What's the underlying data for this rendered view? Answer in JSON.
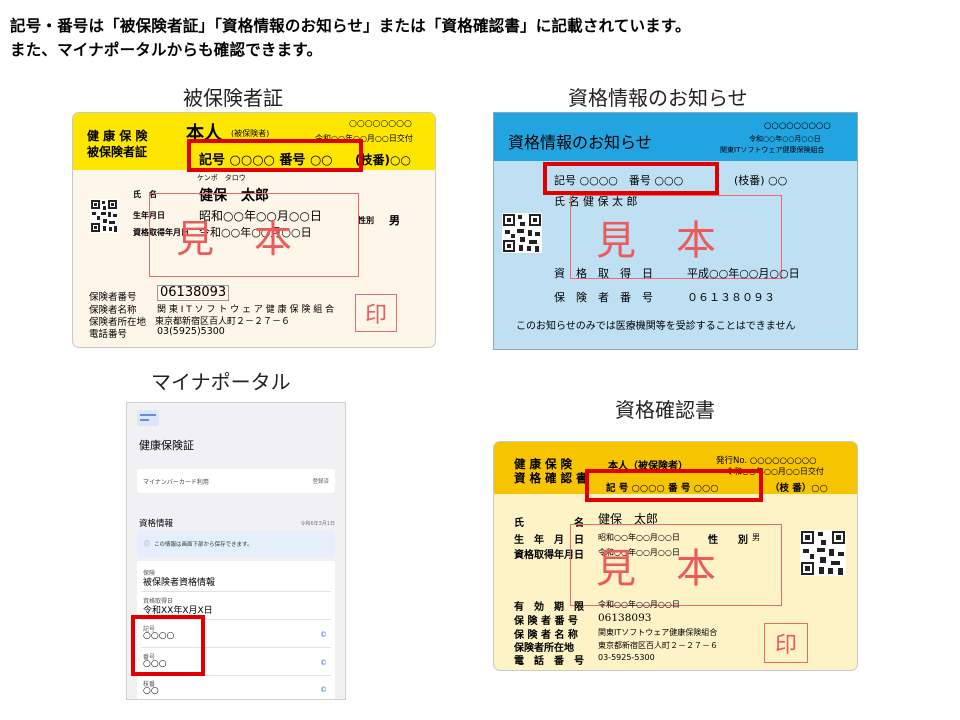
{
  "intro": {
    "line1": "記号・番号は「被保険者証」「資格情報のお知らせ」または「資格確認書」に記載されています。",
    "line2": "また、マイナポータルからも確認できます。"
  },
  "captions": {
    "insurance_card": "被保険者証",
    "notice": "資格情報のお知らせ",
    "myna_portal": "マイナポータル",
    "certificate": "資格確認書"
  },
  "insurance_card": {
    "header_left_1": "健 康 保 険",
    "header_left_2": "被保険者証",
    "person": "本人",
    "person_sub": "(被保険者)",
    "issue_no": "○○○○○○○○",
    "issue_date": "令和○○年○○月○○日交付",
    "kigo": "記号 ○○○○ 番号 ○○",
    "edaban": "(枝番)○○",
    "furigana": "ケンポ　タロウ",
    "name_label": "氏　名",
    "name": "健保　太郎",
    "birth_label": "生年月日",
    "birth": "昭和○○年○○月○○日",
    "sex_label": "性別",
    "sex": "男",
    "acq_label": "資格取得年月日",
    "acq": "令和○○年○○月○○日",
    "insurer_no_label": "保険者番号",
    "insurer_no": "06138093",
    "insurer_name_label": "保険者名称",
    "insurer_name": "関 東 I T ソ フ ト ウ ェ ア 健 康 保 険 組 合",
    "address_label": "保険者所在地",
    "address": "東京都新宿区百人町２－２７－６",
    "phone_label": "電話番号",
    "phone": "03(5925)5300",
    "sample": "見本",
    "seal": "印",
    "color_header": "#ffe600",
    "color_body": "#fdf6e9"
  },
  "notice": {
    "title": "資格情報のお知らせ",
    "issue_no": "○○○○○○○○○",
    "issue_date": "令和○○年○○月○○日",
    "insurer": "関東ITソフトウェア健康保険組合",
    "kigo": "記号 ○○○○　番号 ○○○",
    "edaban": "(枝番) ○○",
    "name_line": "氏 名  健 保   太 郎",
    "acq_label": "資　格　取　得　日",
    "acq": "平成○○年○○月○○日",
    "insurer_no_label": "保　険　者　番　号",
    "insurer_no": "０６１３８０９３",
    "footer": "このお知らせのみでは医療機関等を受診することはできません",
    "sample": "見本",
    "color_header": "#21a4e0",
    "color_body": "#bfe0f3"
  },
  "myna": {
    "section_title": "健康保険証",
    "card_use_label": "マイナンバーカード利用",
    "card_use_value": "登録済",
    "info_title": "資格情報",
    "info_date": "令和6年3月1日",
    "notice_text": "この情報は画面下部から保存できます。",
    "field1_label": "保険",
    "field1_value": "被保険者資格情報",
    "field2_label": "資格取得日",
    "field2_value": "令和XX年X月X日",
    "field3_label": "記号",
    "field3_value": "○○○○",
    "field4_label": "番号",
    "field4_value": "○○○",
    "field5_label": "枝番",
    "field5_value": "○○"
  },
  "certificate": {
    "header_left_1": "健 康 保 険",
    "header_left_2": "資 格 確 認 書",
    "person": "本人（被保険者）",
    "issue_no": "発行No. ○○○○○○○○○",
    "issue_date": "令和○○年○○月○○日交付",
    "kigo": "記 号 ○○○○ 番 号 ○○○",
    "edaban": "（枝 番）○○",
    "name_label": "氏　　　　　名",
    "name": "健保　太郎",
    "birth_label": "生　年　月　日",
    "birth": "昭和○○年○○月○○日",
    "sex_label": "性　　別",
    "sex": "男",
    "acq_label": "資格取得年月日",
    "acq": "令和○○年○○月○○日",
    "valid_label": "有　効　期　限",
    "valid": "令和○○年○○月○○日",
    "insurer_no_label": "保 険 者 番 号",
    "insurer_no": "06138093",
    "insurer_name_label": "保 険 者 名 称",
    "insurer_name": "関東ITソフトウェア健康保険組合",
    "address_label": "保険者所在地",
    "address": "東京都新宿区百人町２－２７－６",
    "phone_label": "電　話　番　号",
    "phone": "03-5925-5300",
    "sample": "見本",
    "seal": "印",
    "color_header": "#f7c400",
    "color_body": "#fdf3c6"
  }
}
